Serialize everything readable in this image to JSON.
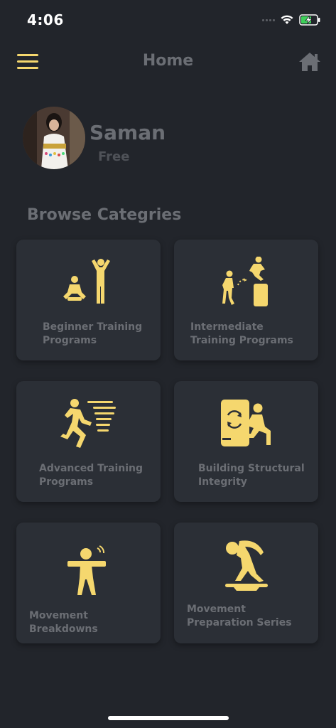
{
  "status": {
    "time": "4:06"
  },
  "header": {
    "title": "Home"
  },
  "profile": {
    "name": "Saman",
    "plan": "Free"
  },
  "browse": {
    "title": "Browse Categries",
    "categories": [
      {
        "label": "Beginner Training Programs",
        "icon": "beginner-figures-icon"
      },
      {
        "label": "Intermediate Training Programs",
        "icon": "jumping-figure-icon"
      },
      {
        "label": "Advanced Training Programs",
        "icon": "running-figure-icon"
      },
      {
        "label": "Building Structural Integrity",
        "icon": "lunge-figure-icon"
      },
      {
        "label": "Movement Breakdowns",
        "icon": "standing-figure-icon"
      },
      {
        "label": "Movement Preparation Series",
        "icon": "stretching-figure-icon"
      }
    ]
  },
  "colors": {
    "accent": "#f5d76e",
    "background": "#22252b",
    "card": "#2b2f36",
    "text": "#6b6e74"
  }
}
